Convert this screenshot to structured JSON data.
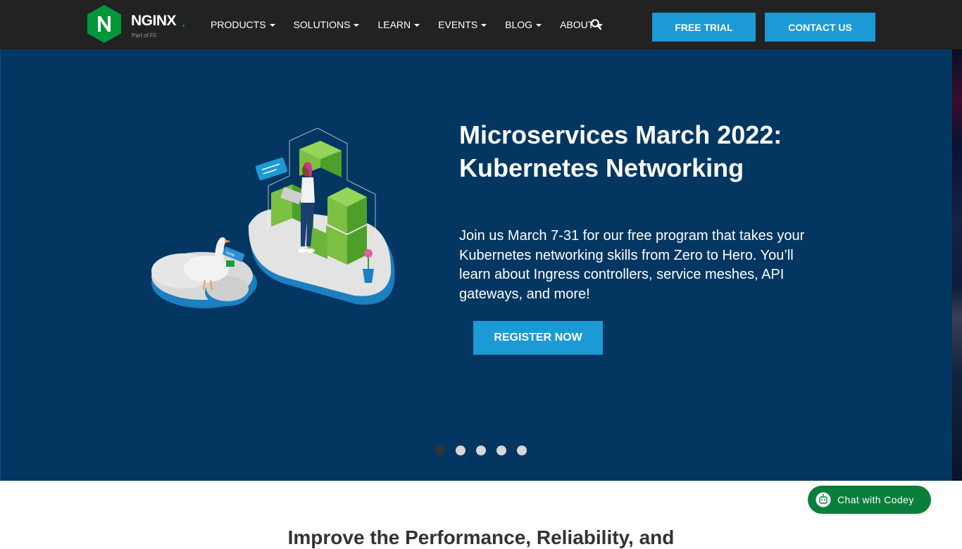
{
  "header": {
    "logo": {
      "wordmark": "NGINX",
      "tagline": "Part of F5"
    },
    "menu": [
      {
        "label": "PRODUCTS"
      },
      {
        "label": "SOLUTIONS"
      },
      {
        "label": "LEARN"
      },
      {
        "label": "EVENTS"
      },
      {
        "label": "BLOG"
      },
      {
        "label": "ABOUT"
      }
    ],
    "search_icon": "search-icon",
    "free_trial_label": "FREE TRIAL",
    "contact_label": "CONTACT US"
  },
  "hero": {
    "title_line1": "Microservices March 2022:",
    "title_line2": "Kubernetes Networking",
    "description": "Join us March 7-31 for our free program that takes your Kubernetes networking skills from Zero to Hero. You’ll learn about Ingress controllers, service meshes, API gateways, and more!",
    "illustration_note": "honk",
    "register_label": "REGISTER NOW",
    "carousel": {
      "slides": 5,
      "active": 1
    }
  },
  "below": {
    "heading": "Improve the Performance, Reliability, and"
  },
  "chat": {
    "label": "Chat with Codey",
    "icon": "chat-bot-icon"
  },
  "colors": {
    "nav_bg": "#222222",
    "hero_bg": "#033762",
    "accent": "#1b9ad6",
    "brand_green": "#009639",
    "chat_bg": "#0a7e3b"
  }
}
